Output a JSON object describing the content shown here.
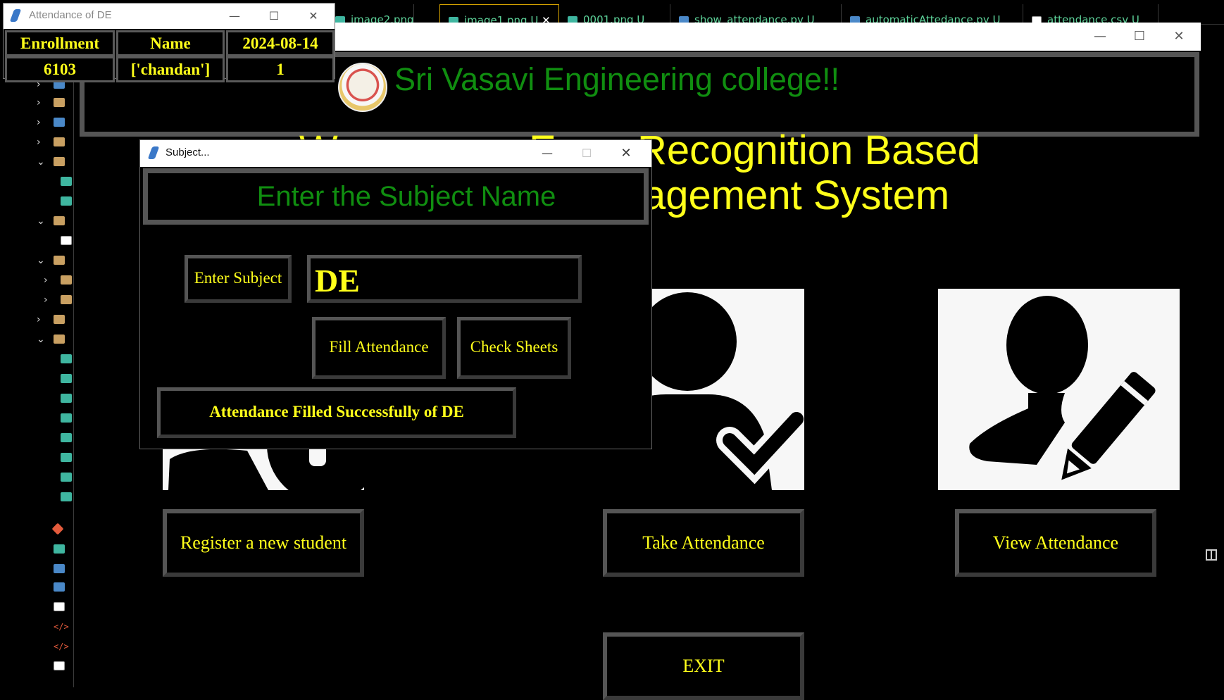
{
  "vscode": {
    "tabs": [
      {
        "label": "image2.png U",
        "icon": "image-icon"
      },
      {
        "label": "image1.png U",
        "icon": "image-icon",
        "active": true
      },
      {
        "label": "0001.png U",
        "icon": "image-icon"
      },
      {
        "label": "show_attendance.py U",
        "icon": "python-icon"
      },
      {
        "label": "automaticAttedance.py U",
        "icon": "python-icon"
      },
      {
        "label": "attendance.csv U",
        "icon": "file-icon"
      }
    ],
    "tab_close_glyph": "✕"
  },
  "window_controls": {
    "minimize": "—",
    "maximize": "☐",
    "close": "✕"
  },
  "main_window": {
    "college_name": "Sri Vasavi Engineering college!!",
    "welcome_line1_left": "W",
    "welcome_line1_mid": "E",
    "welcome_line1_right": "Recognition Based",
    "welcome_line2": "agement System",
    "register_button": "Register a new student",
    "take_attendance_button": "Take Attendance",
    "view_attendance_button": "View Attendance",
    "exit_button": "EXIT"
  },
  "attendance_window": {
    "title": "Attendance of DE",
    "headers": [
      "Enrollment",
      "Name",
      "2024-08-14"
    ],
    "rows": [
      [
        "6103",
        "['chandan']",
        "1"
      ]
    ]
  },
  "subject_dialog": {
    "title": "Subject...",
    "header": "Enter the Subject Name",
    "enter_subject_label": "Enter Subject",
    "subject_value": "DE",
    "fill_attendance_button": "Fill Attendance",
    "check_sheets_button": "Check Sheets",
    "status_message": "Attendance Filled Successfully of DE"
  },
  "colors": {
    "yellow": "#ffff1a",
    "green": "#108e10",
    "background": "#000000",
    "bevel": "#555555"
  }
}
